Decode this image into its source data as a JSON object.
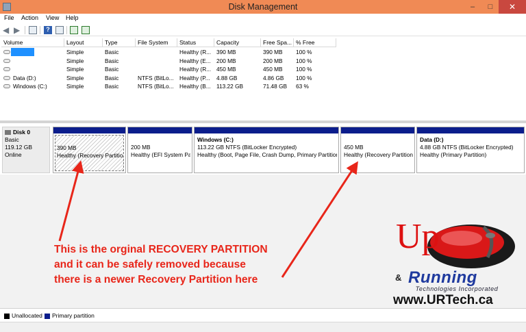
{
  "window": {
    "title": "Disk Management",
    "minimize": "–",
    "maximize": "□",
    "close": "✕"
  },
  "menu": [
    "File",
    "Action",
    "View",
    "Help"
  ],
  "toolbar_icons": [
    "back-arrow-icon",
    "forward-arrow-icon",
    "properties-icon",
    "help-icon",
    "console-tree-icon",
    "refresh-icon",
    "settings-icon"
  ],
  "columns": [
    "Volume",
    "Layout",
    "Type",
    "File System",
    "Status",
    "Capacity",
    "Free Spa...",
    "% Free"
  ],
  "volumes": [
    {
      "volume": "",
      "layout": "Simple",
      "type": "Basic",
      "fs": "",
      "status": "Healthy (R...",
      "capacity": "390 MB",
      "free": "390 MB",
      "pct": "100 %"
    },
    {
      "volume": "",
      "layout": "Simple",
      "type": "Basic",
      "fs": "",
      "status": "Healthy (E...",
      "capacity": "200 MB",
      "free": "200 MB",
      "pct": "100 %"
    },
    {
      "volume": "",
      "layout": "Simple",
      "type": "Basic",
      "fs": "",
      "status": "Healthy (R...",
      "capacity": "450 MB",
      "free": "450 MB",
      "pct": "100 %"
    },
    {
      "volume": "Data (D:)",
      "layout": "Simple",
      "type": "Basic",
      "fs": "NTFS (BitLo...",
      "status": "Healthy (P...",
      "capacity": "4.88 GB",
      "free": "4.86 GB",
      "pct": "100 %"
    },
    {
      "volume": "Windows (C:)",
      "layout": "Simple",
      "type": "Basic",
      "fs": "NTFS (BitLo...",
      "status": "Healthy (B...",
      "capacity": "113.22 GB",
      "free": "71.48 GB",
      "pct": "63 %"
    }
  ],
  "disk": {
    "name": "Disk 0",
    "type": "Basic",
    "size": "119.12 GB",
    "state": "Online"
  },
  "partitions": [
    {
      "name": "",
      "size": "390 MB",
      "status": "Healthy (Recovery Partition)"
    },
    {
      "name": "",
      "size": "200 MB",
      "status": "Healthy (EFI System Partition)"
    },
    {
      "name": "Windows  (C:)",
      "size": "113.22 GB NTFS (BitLocker Encrypted)",
      "status": "Healthy (Boot, Page File, Crash Dump, Primary Partition)"
    },
    {
      "name": "",
      "size": "450 MB",
      "status": "Healthy (Recovery Partition)"
    },
    {
      "name": "Data  (D:)",
      "size": "4.88 GB NTFS (BitLocker Encrypted)",
      "status": "Healthy (Primary Partition)"
    }
  ],
  "legend": [
    {
      "label": "Unallocated",
      "color": "#000000"
    },
    {
      "label": "Primary partition",
      "color": "#0b1d8c"
    }
  ],
  "annotation": [
    "This is the orginal RECOVERY PARTITION",
    "and it can be safely removed because",
    "there is a newer Recovery Partition here"
  ],
  "annotation_color": "#e8261a",
  "logo": {
    "up": "Up",
    "amp": "&",
    "running": "Running",
    "tagline": "Technologies Incorporated",
    "url": "www.URTech.ca"
  }
}
